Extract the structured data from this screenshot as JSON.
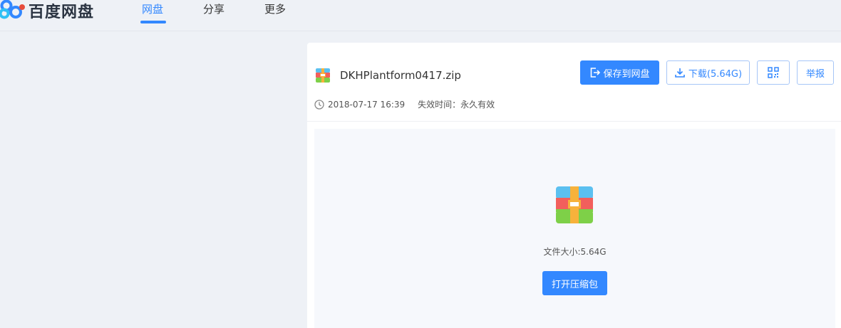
{
  "header": {
    "logo_text": "百度网盘",
    "tabs": [
      {
        "label": "网盘",
        "active": true
      },
      {
        "label": "分享",
        "active": false
      },
      {
        "label": "更多",
        "active": false
      }
    ]
  },
  "file": {
    "name": "DKHPlantform0417.zip",
    "date": "2018-07-17 16:39",
    "expiry": "失效时间：永久有效",
    "icon": "zip-archive-icon"
  },
  "actions": {
    "save_label": "保存到网盘",
    "download_label": "下载(5.64G)",
    "qr_icon": "qrcode-icon",
    "report_label": "举报"
  },
  "preview": {
    "size_text": "文件大小:5.64G",
    "open_label": "打开压缩包"
  },
  "colors": {
    "accent": "#3388ff",
    "page_bg": "#eef1f6",
    "preview_bg": "#f6f8fc"
  }
}
